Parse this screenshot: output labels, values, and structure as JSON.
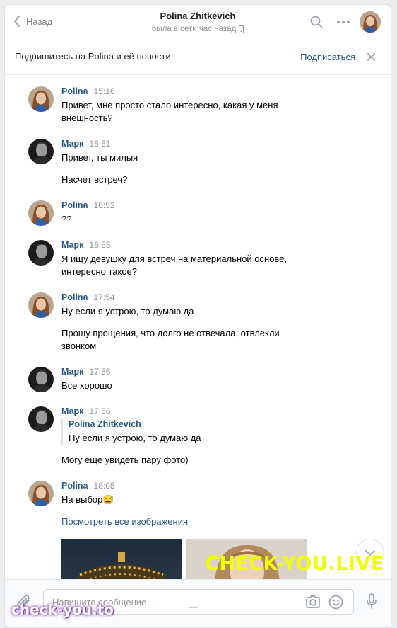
{
  "header": {
    "back_label": "Назад",
    "peer_name": "Polina Zhitkevich",
    "peer_status": "была в сети час назад"
  },
  "subscribe_bar": {
    "text": "Подпишитесь на Polina и её новости",
    "button_label": "Подписаться"
  },
  "messages": [
    {
      "author": "Polina",
      "time": "15:16",
      "lines": [
        "Привет, мне просто стало интересно, какая у меня внешность?"
      ]
    },
    {
      "author": "Марк",
      "time": "16:51",
      "lines": [
        "Привет, ты милыя",
        "Насчет встреч?"
      ]
    },
    {
      "author": "Polina",
      "time": "16:52",
      "lines": [
        "??"
      ]
    },
    {
      "author": "Марк",
      "time": "16:55",
      "lines": [
        "Я ищу девушку для встреч на материальной основе, интересно такое?"
      ]
    },
    {
      "author": "Polina",
      "time": "17:54",
      "lines": [
        "Ну если я устрою, то думаю да",
        "Прошу прощения, что долго не отвечала, отвлекли звонком"
      ]
    },
    {
      "author": "Марк",
      "time": "17:56",
      "lines": [
        "Все хорошо"
      ]
    },
    {
      "author": "Марк",
      "time": "17:56",
      "forward": {
        "author": "Polina Zhitkevich",
        "text": "Ну если я устрою, то думаю да"
      },
      "lines": [
        "Могу еще увидеть пару фото)"
      ]
    },
    {
      "author": "Polina",
      "time": "18:08",
      "lines": [
        "На выбор😅"
      ],
      "link": "Посмотреть все изображения"
    }
  ],
  "composer": {
    "placeholder": "Напишите сообщение..."
  },
  "watermarks": {
    "main": "CHECK-YOU.LIVE",
    "corner": "check-you.to"
  },
  "colors": {
    "link": "#2a5885",
    "accent_watermark": "#f2ff00",
    "muted": "#939393"
  }
}
